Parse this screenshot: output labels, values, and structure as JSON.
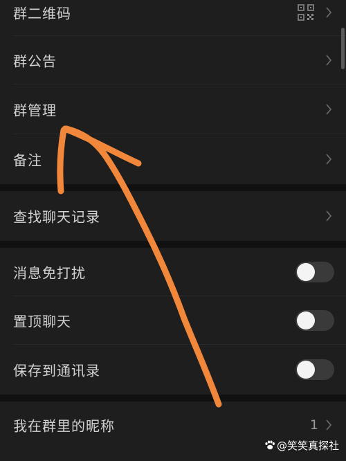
{
  "settings": {
    "group_qrcode": {
      "label": "群二维码",
      "icon": "qr-code-icon"
    },
    "group_notice": {
      "label": "群公告"
    },
    "group_manage": {
      "label": "群管理"
    },
    "remark": {
      "label": "备注"
    },
    "search_history": {
      "label": "查找聊天记录"
    },
    "mute_notifications": {
      "label": "消息免打扰",
      "enabled": false
    },
    "pin_chat": {
      "label": "置顶聊天",
      "enabled": false
    },
    "save_to_contacts": {
      "label": "保存到通讯录",
      "enabled": false
    },
    "my_nickname": {
      "label": "我在群里的昵称",
      "value": "1"
    }
  },
  "watermark": {
    "text": "@笑笑真探社",
    "icon": "paw-icon"
  },
  "colors": {
    "background": "#111111",
    "row": "#1e1e1e",
    "text": "#d2d2d2",
    "toggle_off": "#3a3a3a",
    "annotation_arrow": "#f0873a"
  }
}
